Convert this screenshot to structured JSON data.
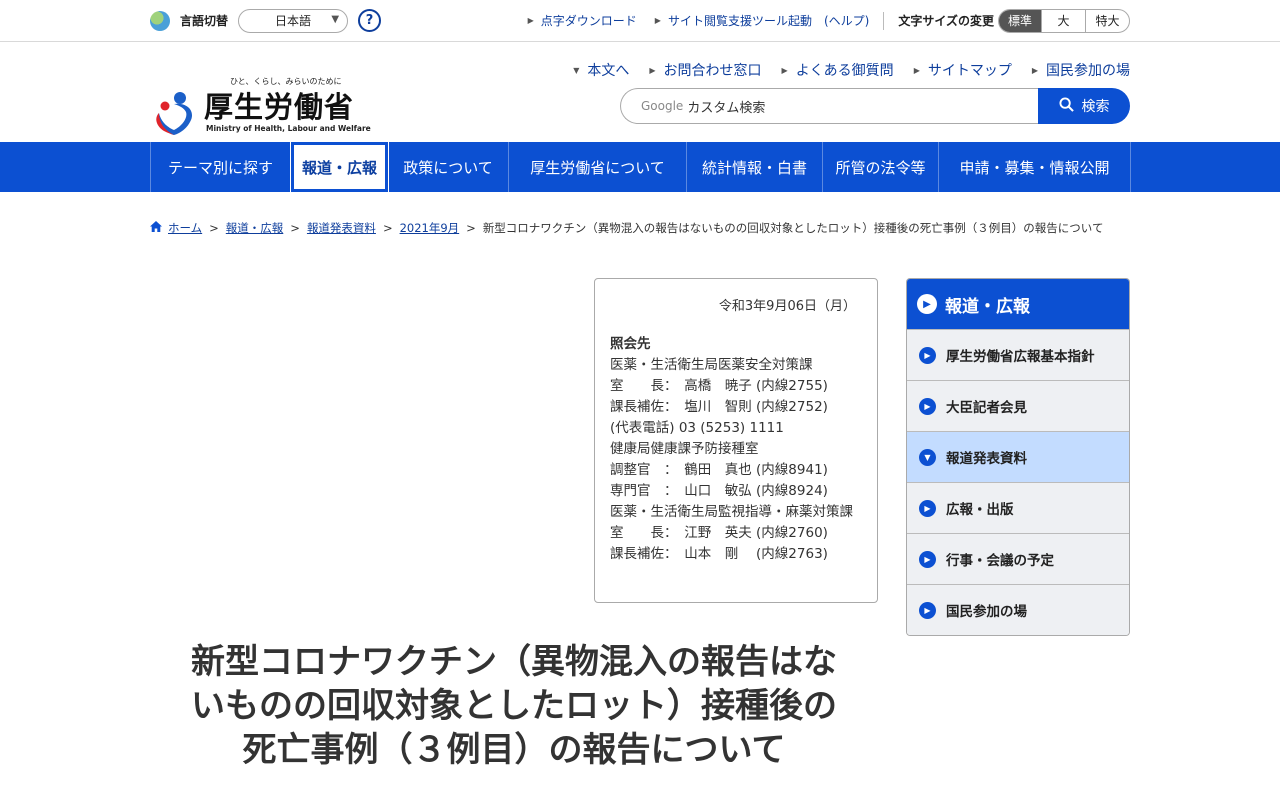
{
  "utility": {
    "lang_label": "言語切替",
    "lang_value": "日本語",
    "help_label": "?",
    "braille_label": "点字ダウンロード",
    "a11y_tool_label": "サイト閲覧支援ツール起動",
    "a11y_help_label": "(ヘルプ)",
    "font_size_label": "文字サイズの変更",
    "font_sizes": [
      "標準",
      "大",
      "特大"
    ]
  },
  "logo": {
    "tagline": "ひと、くらし、みらいのために",
    "name": "厚生労働省",
    "english": "Ministry of Health, Labour and Welfare"
  },
  "header_links": [
    "本文へ",
    "お問合わせ窓口",
    "よくある御質問",
    "サイトマップ",
    "国民参加の場"
  ],
  "search": {
    "google_label": "Google",
    "placeholder": "カスタム検索",
    "button_label": "検索"
  },
  "global_nav": [
    "テーマ別に探す",
    "報道・広報",
    "政策について",
    "厚生労働省について",
    "統計情報・白書",
    "所管の法令等",
    "申請・募集・情報公開"
  ],
  "breadcrumb": {
    "items": [
      "ホーム",
      "報道・広報",
      "報道発表資料",
      "2021年9月"
    ],
    "current": "新型コロナワクチン（異物混入の報告はないものの回収対象としたロット）接種後の死亡事例（３例目）の報告について"
  },
  "contact": {
    "date": "令和3年9月06日（月）",
    "heading": "照会先",
    "lines": [
      "医薬・生活衛生局医薬安全対策課",
      "室　　長：　高橋　暁子 (内線2755)",
      "課長補佐：　塩川　智則 (内線2752)",
      "(代表電話) 03 (5253) 1111",
      "健康局健康課予防接種室",
      "調整官　：　鶴田　真也 (内線8941)",
      "専門官　：　山口　敏弘 (内線8924)",
      "医薬・生活衛生局監視指導・麻薬対策課",
      "室　　長：　江野　英夫 (内線2760)",
      "課長補佐：　山本　剛　 (内線2763)"
    ]
  },
  "page_title": {
    "line1": "新型コロナワクチン（異物混入の報告はな",
    "line2": "いものの回収対象としたロット）接種後の",
    "line3": "死亡事例（３例目）の報告について"
  },
  "side_nav": {
    "heading": "報道・広報",
    "items": [
      "厚生労働省広報基本指針",
      "大臣記者会見",
      "報道発表資料",
      "広報・出版",
      "行事・会議の予定",
      "国民参加の場"
    ]
  },
  "colors": {
    "brand_blue": "#0c50d2",
    "link_blue": "#0e3e9c",
    "side_active": "#c3dcff"
  }
}
